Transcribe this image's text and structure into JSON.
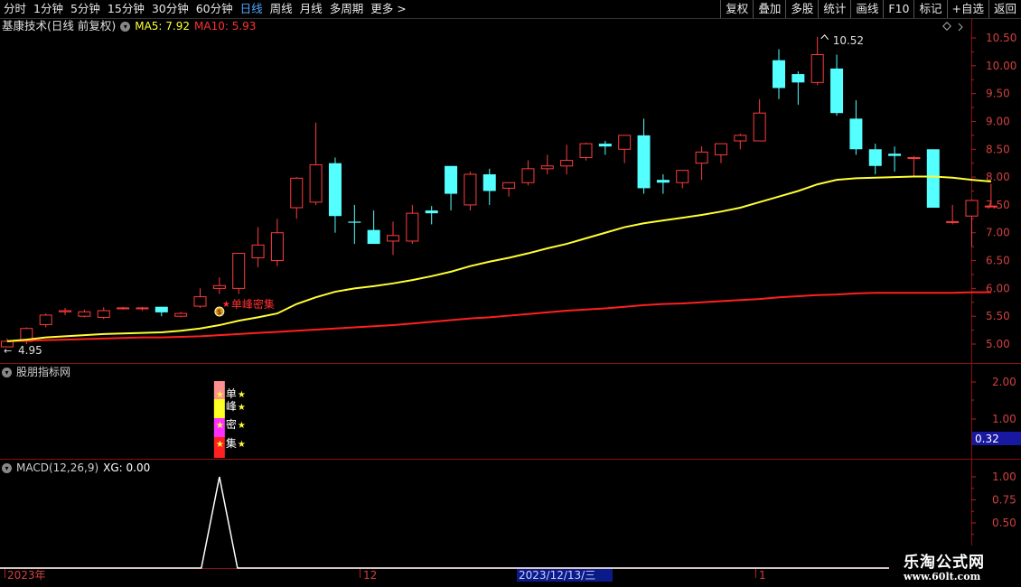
{
  "toolbar": {
    "periods": [
      "分时",
      "1分钟",
      "5分钟",
      "15分钟",
      "30分钟",
      "60分钟",
      "日线",
      "周线",
      "月线",
      "多周期",
      "更多"
    ],
    "active_period": "日线",
    "more_arrow": ">",
    "buttons": [
      "复权",
      "叠加",
      "多股",
      "统计",
      "画线",
      "F10",
      "标记",
      "+自选",
      "返回"
    ]
  },
  "main_panel": {
    "title": "基康技术(日线 前复权)",
    "ma5_label": "MA5: 7.92",
    "ma10_label": "MA10: 5.93",
    "high_label": "10.52",
    "low_label": "4.95",
    "annotation": "单峰密集",
    "y_ticks": [
      "10.50",
      "10.00",
      "9.50",
      "9.00",
      "8.50",
      "8.00",
      "7.50",
      "7.00",
      "6.50",
      "6.00",
      "5.50",
      "5.00"
    ]
  },
  "indicator_panel": {
    "title": "股朋指标网",
    "y_ticks": [
      "2.00",
      "1.00"
    ],
    "value_box": "0.32",
    "signal_chars": [
      "单",
      "峰",
      "密",
      "集"
    ]
  },
  "macd_panel": {
    "title": "MACD(12,26,9)",
    "xg_label": "XG: 0.00",
    "y_ticks": [
      "1.00",
      "0.75",
      "0.50"
    ]
  },
  "time_axis": {
    "labels": [
      "2023年",
      "12",
      "2023/12/13/三",
      "1"
    ]
  },
  "watermark": {
    "line1": "乐淘公式网",
    "line2": "www.60lt.com"
  },
  "colors": {
    "up": "#ff3c3c",
    "down": "#54ffff",
    "ma5": "#ffff33",
    "ma10": "#ff2020",
    "background": "#000000",
    "active": "#4fa8ff"
  },
  "chart_data": {
    "type": "candlestick",
    "y_range_main": [
      4.8,
      10.7
    ],
    "candles": [
      {
        "o": 4.95,
        "h": 5.1,
        "l": 4.95,
        "c": 5.05
      },
      {
        "o": 5.05,
        "h": 5.3,
        "l": 5.0,
        "c": 5.28
      },
      {
        "o": 5.35,
        "h": 5.55,
        "l": 5.3,
        "c": 5.52
      },
      {
        "o": 5.58,
        "h": 5.65,
        "l": 5.52,
        "c": 5.6
      },
      {
        "o": 5.5,
        "h": 5.62,
        "l": 5.48,
        "c": 5.58
      },
      {
        "o": 5.48,
        "h": 5.66,
        "l": 5.45,
        "c": 5.6
      },
      {
        "o": 5.65,
        "h": 5.67,
        "l": 5.62,
        "c": 5.65
      },
      {
        "o": 5.65,
        "h": 5.67,
        "l": 5.6,
        "c": 5.65
      },
      {
        "o": 5.67,
        "h": 5.67,
        "l": 5.5,
        "c": 5.57
      },
      {
        "o": 5.5,
        "h": 5.58,
        "l": 5.48,
        "c": 5.55
      },
      {
        "o": 5.68,
        "h": 6.0,
        "l": 5.65,
        "c": 5.85
      },
      {
        "o": 6.0,
        "h": 6.2,
        "l": 5.9,
        "c": 6.05
      },
      {
        "o": 6.0,
        "h": 6.62,
        "l": 5.9,
        "c": 6.63
      },
      {
        "o": 6.55,
        "h": 7.1,
        "l": 6.38,
        "c": 6.78
      },
      {
        "o": 6.5,
        "h": 7.25,
        "l": 6.4,
        "c": 7.0
      },
      {
        "o": 7.45,
        "h": 8.0,
        "l": 7.25,
        "c": 7.98
      },
      {
        "o": 7.55,
        "h": 8.98,
        "l": 7.5,
        "c": 8.22
      },
      {
        "o": 8.25,
        "h": 8.35,
        "l": 7.0,
        "c": 7.3
      },
      {
        "o": 7.2,
        "h": 7.5,
        "l": 6.8,
        "c": 7.18
      },
      {
        "o": 7.05,
        "h": 7.4,
        "l": 6.8,
        "c": 6.8
      },
      {
        "o": 6.85,
        "h": 7.2,
        "l": 6.6,
        "c": 6.95
      },
      {
        "o": 6.85,
        "h": 7.5,
        "l": 6.8,
        "c": 7.35
      },
      {
        "o": 7.4,
        "h": 7.48,
        "l": 7.15,
        "c": 7.35
      },
      {
        "o": 8.2,
        "h": 8.2,
        "l": 7.4,
        "c": 7.7
      },
      {
        "o": 7.5,
        "h": 8.1,
        "l": 7.4,
        "c": 8.05
      },
      {
        "o": 8.05,
        "h": 8.15,
        "l": 7.5,
        "c": 7.75
      },
      {
        "o": 7.8,
        "h": 7.9,
        "l": 7.65,
        "c": 7.9
      },
      {
        "o": 7.9,
        "h": 8.3,
        "l": 7.85,
        "c": 8.15
      },
      {
        "o": 8.15,
        "h": 8.4,
        "l": 8.05,
        "c": 8.2
      },
      {
        "o": 8.2,
        "h": 8.58,
        "l": 8.05,
        "c": 8.3
      },
      {
        "o": 8.35,
        "h": 8.62,
        "l": 8.3,
        "c": 8.6
      },
      {
        "o": 8.6,
        "h": 8.65,
        "l": 8.4,
        "c": 8.55
      },
      {
        "o": 8.5,
        "h": 8.75,
        "l": 8.25,
        "c": 8.75
      },
      {
        "o": 8.75,
        "h": 9.05,
        "l": 7.7,
        "c": 7.8
      },
      {
        "o": 7.95,
        "h": 8.05,
        "l": 7.7,
        "c": 7.9
      },
      {
        "o": 7.9,
        "h": 8.1,
        "l": 7.8,
        "c": 8.12
      },
      {
        "o": 8.25,
        "h": 8.55,
        "l": 7.95,
        "c": 8.45
      },
      {
        "o": 8.4,
        "h": 8.6,
        "l": 8.25,
        "c": 8.6
      },
      {
        "o": 8.65,
        "h": 8.78,
        "l": 8.5,
        "c": 8.75
      },
      {
        "o": 8.65,
        "h": 9.4,
        "l": 8.65,
        "c": 9.15
      },
      {
        "o": 10.1,
        "h": 10.3,
        "l": 9.4,
        "c": 9.6
      },
      {
        "o": 9.85,
        "h": 9.9,
        "l": 9.3,
        "c": 9.7
      },
      {
        "o": 9.7,
        "h": 10.52,
        "l": 9.65,
        "c": 10.2
      },
      {
        "o": 9.95,
        "h": 10.2,
        "l": 9.1,
        "c": 9.15
      },
      {
        "o": 9.05,
        "h": 9.38,
        "l": 8.4,
        "c": 8.5
      },
      {
        "o": 8.5,
        "h": 8.6,
        "l": 8.05,
        "c": 8.2
      },
      {
        "o": 8.42,
        "h": 8.55,
        "l": 8.1,
        "c": 8.38
      },
      {
        "o": 8.35,
        "h": 8.38,
        "l": 8.0,
        "c": 8.35
      },
      {
        "o": 8.5,
        "h": 8.5,
        "l": 7.45,
        "c": 7.45
      },
      {
        "o": 7.2,
        "h": 7.5,
        "l": 7.15,
        "c": 7.2
      },
      {
        "o": 7.3,
        "h": 7.6,
        "l": 6.75,
        "c": 7.58
      },
      {
        "o": 7.48,
        "h": 7.88,
        "l": 7.48,
        "c": 7.48
      }
    ],
    "ma5": [
      5.05,
      5.08,
      5.12,
      5.14,
      5.16,
      5.18,
      5.19,
      5.2,
      5.21,
      5.24,
      5.28,
      5.34,
      5.42,
      5.48,
      5.55,
      5.72,
      5.84,
      5.94,
      6.0,
      6.04,
      6.09,
      6.15,
      6.22,
      6.3,
      6.4,
      6.48,
      6.55,
      6.63,
      6.72,
      6.8,
      6.9,
      7.0,
      7.1,
      7.17,
      7.22,
      7.27,
      7.32,
      7.38,
      7.45,
      7.55,
      7.65,
      7.75,
      7.87,
      7.95,
      7.98,
      7.99,
      8.0,
      8.01,
      8.01,
      7.99,
      7.95,
      7.92
    ],
    "ma10": [
      5.05,
      5.06,
      5.07,
      5.08,
      5.09,
      5.1,
      5.11,
      5.12,
      5.12,
      5.13,
      5.14,
      5.16,
      5.18,
      5.2,
      5.22,
      5.24,
      5.26,
      5.28,
      5.3,
      5.32,
      5.34,
      5.37,
      5.4,
      5.43,
      5.46,
      5.48,
      5.51,
      5.54,
      5.57,
      5.6,
      5.62,
      5.64,
      5.67,
      5.7,
      5.72,
      5.73,
      5.75,
      5.77,
      5.79,
      5.81,
      5.84,
      5.86,
      5.88,
      5.89,
      5.91,
      5.92,
      5.92,
      5.92,
      5.92,
      5.92,
      5.93,
      5.93
    ],
    "macd_xg": {
      "y_range": [
        0.35,
        1.05
      ],
      "spike_index": 11,
      "spike_value": 1.0
    }
  }
}
